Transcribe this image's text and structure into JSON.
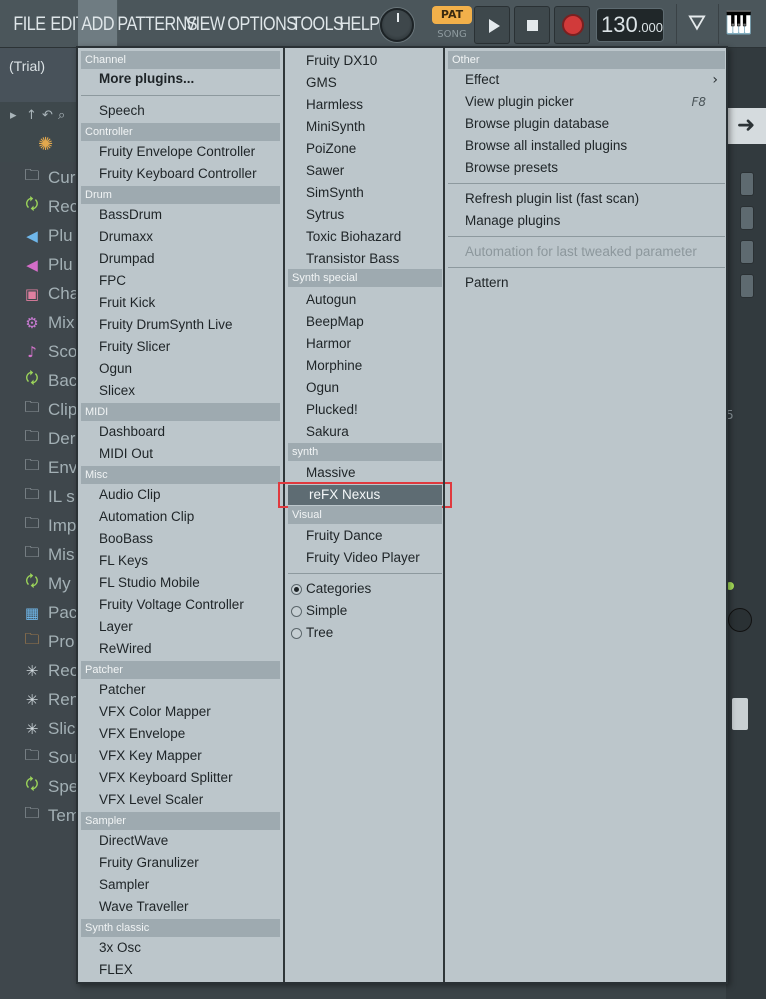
{
  "menubar": {
    "items": [
      "FILE",
      "EDIT",
      "ADD",
      "PATTERNS",
      "VIEW",
      "OPTIONS",
      "TOOLS",
      "HELP"
    ],
    "active": "ADD",
    "pat_label": "PAT",
    "song_label": "SONG",
    "tempo_int": "130",
    "tempo_dec": ".000"
  },
  "hint": {
    "text": "(Trial)"
  },
  "browser": {
    "items": [
      {
        "label": "Cur",
        "icon": "folder-icon",
        "color": "#cfd8dc"
      },
      {
        "label": "Rec",
        "icon": "folder-refresh-icon",
        "color": "#9bd35a"
      },
      {
        "label": "Plu",
        "icon": "speaker-icon",
        "color": "#6fb7ea"
      },
      {
        "label": "Plu",
        "icon": "speaker-icon",
        "color": "#d46dc8"
      },
      {
        "label": "Cha",
        "icon": "channel-icon",
        "color": "#e07fa0"
      },
      {
        "label": "Mix",
        "icon": "mixer-icon",
        "color": "#c77ad0"
      },
      {
        "label": "Sco",
        "icon": "note-icon",
        "color": "#d473cb"
      },
      {
        "label": "Bac",
        "icon": "folder-refresh-icon",
        "color": "#9bd35a"
      },
      {
        "label": "Clip",
        "icon": "folder-icon",
        "color": "#cfd8dc"
      },
      {
        "label": "Der",
        "icon": "folder-icon",
        "color": "#cfd8dc"
      },
      {
        "label": "Env",
        "icon": "folder-icon",
        "color": "#cfd8dc"
      },
      {
        "label": "IL s",
        "icon": "folder-icon",
        "color": "#cfd8dc"
      },
      {
        "label": "Imp",
        "icon": "folder-icon",
        "color": "#cfd8dc"
      },
      {
        "label": "Mis",
        "icon": "folder-icon",
        "color": "#cfd8dc"
      },
      {
        "label": "My",
        "icon": "folder-refresh-icon",
        "color": "#9bd35a"
      },
      {
        "label": "Pac",
        "icon": "pack-icon",
        "color": "#6fb7ea"
      },
      {
        "label": "Pro",
        "icon": "folder-icon",
        "color": "#e8a04a"
      },
      {
        "label": "Rec",
        "icon": "wave-icon",
        "color": "#cfd8dc"
      },
      {
        "label": "Ren",
        "icon": "wave-icon",
        "color": "#cfd8dc"
      },
      {
        "label": "Slic",
        "icon": "wave-icon",
        "color": "#cfd8dc"
      },
      {
        "label": "Sou",
        "icon": "folder-icon",
        "color": "#cfd8dc"
      },
      {
        "label": "Spe",
        "icon": "folder-refresh-icon",
        "color": "#9bd35a"
      },
      {
        "label": "Tem",
        "icon": "folder-icon",
        "color": "#cfd8dc"
      }
    ]
  },
  "menu": {
    "col1": {
      "headers": [
        "Channel",
        "Controller",
        "Drum",
        "MIDI",
        "Misc",
        "Patcher",
        "Sampler",
        "Synth classic"
      ],
      "more_plugins": "More plugins...",
      "items": [
        "Speech",
        "Fruity Envelope Controller",
        "Fruity Keyboard Controller",
        "BassDrum",
        "Drumaxx",
        "Drumpad",
        "FPC",
        "Fruit Kick",
        "Fruity DrumSynth Live",
        "Fruity Slicer",
        "Ogun",
        "Slicex",
        "Dashboard",
        "MIDI Out",
        "Audio Clip",
        "Automation Clip",
        "BooBass",
        "FL Keys",
        "FL Studio Mobile",
        "Fruity Voltage Controller",
        "Layer",
        "ReWired",
        "Patcher",
        "VFX Color Mapper",
        "VFX Envelope",
        "VFX Key Mapper",
        "VFX Keyboard Splitter",
        "VFX Level Scaler",
        "DirectWave",
        "Fruity Granulizer",
        "Sampler",
        "Wave Traveller",
        "3x Osc",
        "FLEX"
      ]
    },
    "col2": {
      "headers": [
        "Synth special",
        "synth",
        "Visual"
      ],
      "items": [
        "Fruity DX10",
        "GMS",
        "Harmless",
        "MiniSynth",
        "PoiZone",
        "Sawer",
        "SimSynth",
        "Sytrus",
        "Toxic Biohazard",
        "Transistor Bass",
        "Autogun",
        "BeepMap",
        "Harmor",
        "Morphine",
        "Ogun",
        "Plucked!",
        "Sakura",
        "Massive",
        "reFX Nexus",
        "Fruity Dance",
        "Fruity Video Player"
      ],
      "view_modes": [
        "Categories",
        "Simple",
        "Tree"
      ],
      "selected_view": "Categories",
      "highlighted": "reFX Nexus"
    },
    "col3": {
      "header": "Other",
      "items": [
        "Effect",
        "View plugin picker",
        "Browse plugin database",
        "Browse all installed plugins",
        "Browse presets",
        "Refresh plugin list (fast scan)",
        "Manage plugins",
        "Automation for last tweaked parameter",
        "Pattern"
      ],
      "view_picker_shortcut": "F8"
    }
  },
  "colors": {
    "highlight": "#5e6c73",
    "selection_outline": "#e0393e",
    "menu_bg": "#bcc6cb"
  }
}
